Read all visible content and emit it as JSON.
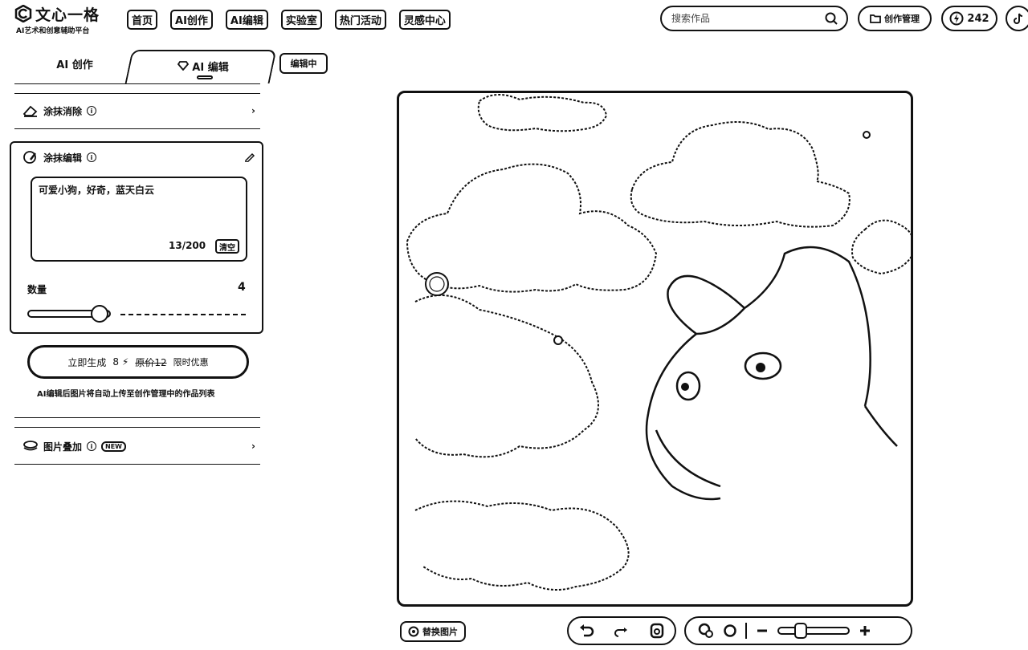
{
  "brand": {
    "title": "文心一格",
    "subtitle": "AI艺术和创意辅助平台"
  },
  "nav": [
    "首页",
    "AI创作",
    "AI编辑",
    "实验室",
    "热门活动",
    "灵感中心"
  ],
  "search": {
    "placeholder": "搜索作品"
  },
  "header": {
    "my_works": "创作管理",
    "credits": "242"
  },
  "tabs": {
    "create": "AI 创作",
    "edit": "AI 编辑"
  },
  "editing_badge": "编辑中",
  "panel": {
    "erase_label": "涂抹消除",
    "edit_label": "涂抹编辑",
    "prompt_text": "可爱小狗，好奇，蓝天白云",
    "counter": "13/200",
    "clear_label": "清空",
    "qty_label": "数量",
    "qty_value": "4",
    "qty_fraction": 0.33,
    "generate": {
      "label": "立即生成",
      "cost": "8",
      "original_cost": "原价12",
      "promo": "限时优惠"
    },
    "disclaimer": "AI编辑后图片将自动上传至创作管理中的作品列表",
    "overlay_label": "图片叠加",
    "new_badge": "NEW"
  },
  "toolbar": {
    "replace_label": "替换图片",
    "zoom_fraction": 0.3
  },
  "icons": [
    "logo-icon",
    "search-icon",
    "folder-icon",
    "lightning-icon",
    "tiktok-icon",
    "diamond-icon",
    "eraser-icon",
    "brush-icon",
    "info-icon",
    "chevron-right-icon",
    "edit-pen-icon",
    "layers-icon",
    "undo-icon",
    "redo-icon",
    "save-icon",
    "brush-size-icon",
    "reset-icon",
    "zoom-out-icon",
    "zoom-in-icon",
    "replace-icon"
  ]
}
